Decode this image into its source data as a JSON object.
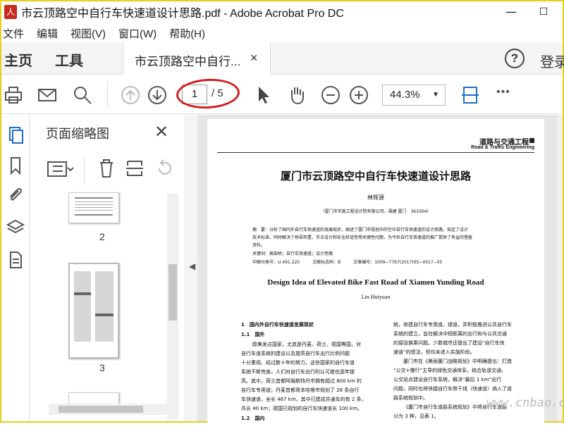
{
  "window": {
    "title": "市云顶路空中自行车快速道设计思路.pdf - Adobe Acrobat Pro DC",
    "minimize": "—",
    "maximize": "☐"
  },
  "menu": [
    "文件",
    "编辑",
    "视图(V)",
    "窗口(W)",
    "帮助(H)"
  ],
  "tabs": {
    "home": "主页",
    "tools": "工具",
    "document": "市云顶路空中自行...",
    "close": "×",
    "help": "?",
    "login": "登录"
  },
  "toolbar": {
    "current_page": "1",
    "total_pages": "/ 5",
    "zoom": "44.3%",
    "more": "•••"
  },
  "thumbnails": {
    "title": "页面缩略图",
    "close": "✕",
    "pages": [
      "2",
      "3"
    ]
  },
  "document": {
    "journal_cn": "道路与交通工程",
    "journal_en": "Road & Traffic Engineering",
    "title_cn": "厦门市云顶路空中自行车快速道设计思路",
    "author_cn": "林辉源",
    "affiliation": "（厦门市市政工程设计院有限公司，福建 厦门　361004）",
    "abstract": [
      "摘　要：分析了国内外自行车快速道的发展现状，阐述了厦门市规划中的空中自行车快速道的设计思路，拟定了设计",
      "技术标准，同时解决了桥梁布置、节点设计和安全舒适性等关键性问题，为今后自行车快速道的推广提供了有益的借鉴",
      "资料。"
    ],
    "keywords": "关键词：高架桥；自行车快速道；设计思路",
    "class_line": "中图分类号：U 491.225　　　文献标志码：B　　　文章编号：1009−7767(2017)05−0017−05",
    "title_en": "Design Idea of Elevated Bike Fast Road of Xiamen Yunding Road",
    "author_en": "Lin Huiyuan",
    "section1": "1　国内外自行车快速道发展现状",
    "section11": "1.1　国外",
    "left_col": [
      "欧美发达国家，尤其是丹麦、荷兰、德国等国，对",
      "自行车道系统的建设以及提高自行车出行比例问题",
      "十分重视。经过数十年的努力，这些国家的自行车道",
      "系统不断完善，人们对自行车出行的认可度也逐年提",
      "高。其中，荷兰首都阿姆斯特丹市拥有超过 800 km 的",
      "自行车专用道；丹麦首都哥本哈根市规划了 28 条自行",
      "车快速道，全长 467 km，其中已建成并通车的有 2 条，",
      "共长 40 km；德国已规划的自行车快速道长 100 km。"
    ],
    "section12": "1.2　国内",
    "right_col": [
      "统，修建自行车专用道、绿道，并积极推进公共自行车",
      "系统的建立，旨在解决中短距离的出行和与公共交通",
      "的接驳换乘问题。少数城市还提出了建设“自行车快",
      "速道”的想法，但均未进入实施阶段。",
      "厦门市在《美丽厦门战略规划》中明确提出：打造",
      "“公交+慢行”主导的绿色交通体系，结合轨道交通、",
      "公交站点建设自行车系统，解决“最后 1 km”出行",
      "问题，同时也将快捷自行车骨干线（快速道）纳入了道",
      "路系统规划中。",
      "《厦门市自行车道路系统规划》中将自行车道路",
      "分为 3 种，见表 1。"
    ]
  },
  "watermark": "www.cnbao.com"
}
